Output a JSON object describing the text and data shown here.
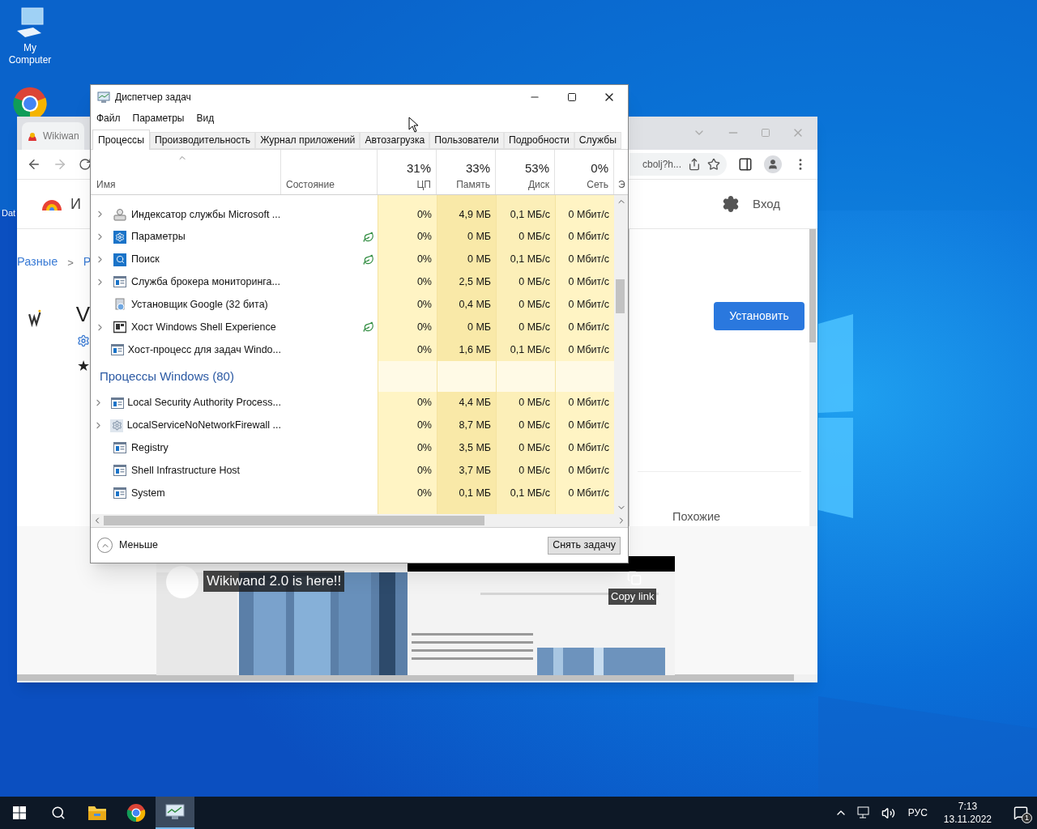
{
  "desktop": {
    "computer_label": "My Computer",
    "partial_label": "Dat"
  },
  "browser": {
    "tab_title": "Wikiwan",
    "address": "cbolj?h...",
    "signin": "Вход",
    "header_fragment": "И",
    "breadcrumb": [
      "Разные",
      ">",
      "Р"
    ],
    "title_fragment": "V",
    "rating_fragment": "★",
    "install_button": "Установить",
    "similar": "Похожие",
    "video": {
      "title": "Wikiwand 2.0 is here!!",
      "copy_link": "Copy link"
    }
  },
  "task_manager": {
    "title": "Диспетчер задач",
    "menu": [
      "Файл",
      "Параметры",
      "Вид"
    ],
    "tabs": [
      {
        "label": "Процессы",
        "selected": true
      },
      {
        "label": "Производительность",
        "selected": false
      },
      {
        "label": "Журнал приложений",
        "selected": false
      },
      {
        "label": "Автозагрузка",
        "selected": false
      },
      {
        "label": "Пользователи",
        "selected": false
      },
      {
        "label": "Подробности",
        "selected": false
      },
      {
        "label": "Службы",
        "selected": false
      }
    ],
    "columns": {
      "name": "Имя",
      "status": "Состояние",
      "metrics": [
        {
          "percent": "31%",
          "label": "ЦП"
        },
        {
          "percent": "33%",
          "label": "Память"
        },
        {
          "percent": "53%",
          "label": "Диск"
        },
        {
          "percent": "0%",
          "label": "Сеть"
        }
      ],
      "partial": "Э"
    },
    "groups": [
      {
        "rows": [
          {
            "name": "Индексатор службы Microsoft ...",
            "kind": "indexer",
            "expandable": true,
            "eco": false,
            "cpu": "0%",
            "memory": "4,9 МБ",
            "disk": "0,1 МБ/с",
            "network": "0 Мбит/с"
          },
          {
            "name": "Параметры",
            "kind": "settings",
            "expandable": true,
            "eco": true,
            "cpu": "0%",
            "memory": "0 МБ",
            "disk": "0 МБ/с",
            "network": "0 Мбит/с"
          },
          {
            "name": "Поиск",
            "kind": "search",
            "expandable": true,
            "eco": true,
            "cpu": "0%",
            "memory": "0 МБ",
            "disk": "0,1 МБ/с",
            "network": "0 Мбит/с"
          },
          {
            "name": "Служба брокера мониторинга...",
            "kind": "service",
            "expandable": true,
            "eco": false,
            "cpu": "0%",
            "memory": "2,5 МБ",
            "disk": "0 МБ/с",
            "network": "0 Мбит/с"
          },
          {
            "name": "Установщик Google (32 бита)",
            "kind": "installer",
            "expandable": false,
            "eco": false,
            "cpu": "0%",
            "memory": "0,4 МБ",
            "disk": "0 МБ/с",
            "network": "0 Мбит/с"
          },
          {
            "name": "Хост Windows Shell Experience",
            "kind": "shell",
            "expandable": true,
            "eco": true,
            "cpu": "0%",
            "memory": "0 МБ",
            "disk": "0 МБ/с",
            "network": "0 Мбит/с"
          },
          {
            "name": "Хост-процесс для задач Windo...",
            "kind": "service",
            "expandable": false,
            "eco": false,
            "cpu": "0%",
            "memory": "1,6 МБ",
            "disk": "0,1 МБ/с",
            "network": "0 Мбит/с"
          }
        ]
      },
      {
        "heading": "Процессы Windows (80)",
        "rows": [
          {
            "name": "Local Security Authority Process...",
            "kind": "service",
            "expandable": true,
            "eco": false,
            "cpu": "0%",
            "memory": "4,4 МБ",
            "disk": "0 МБ/с",
            "network": "0 Мбит/с"
          },
          {
            "name": "LocalServiceNoNetworkFirewall ...",
            "kind": "gear",
            "expandable": true,
            "eco": false,
            "cpu": "0%",
            "memory": "8,7 МБ",
            "disk": "0 МБ/с",
            "network": "0 Мбит/с"
          },
          {
            "name": "Registry",
            "kind": "service",
            "expandable": false,
            "eco": false,
            "cpu": "0%",
            "memory": "3,5 МБ",
            "disk": "0 МБ/с",
            "network": "0 Мбит/с"
          },
          {
            "name": "Shell Infrastructure Host",
            "kind": "service",
            "expandable": false,
            "eco": false,
            "cpu": "0%",
            "memory": "3,7 МБ",
            "disk": "0 МБ/с",
            "network": "0 Мбит/с"
          },
          {
            "name": "System",
            "kind": "service",
            "expandable": false,
            "eco": false,
            "cpu": "0%",
            "memory": "0,1 МБ",
            "disk": "0,1 МБ/с",
            "network": "0 Мбит/с"
          }
        ]
      }
    ],
    "footer": {
      "less": "Меньше",
      "end_task": "Снять задачу"
    }
  },
  "taskbar": {
    "apps": [
      {
        "kind": "explorer",
        "selected": false
      },
      {
        "kind": "chrome",
        "selected": false
      },
      {
        "kind": "taskmgr",
        "selected": true
      }
    ],
    "language": "РУС",
    "time": "7:13",
    "date": "13.11.2022",
    "notifications": "1"
  }
}
